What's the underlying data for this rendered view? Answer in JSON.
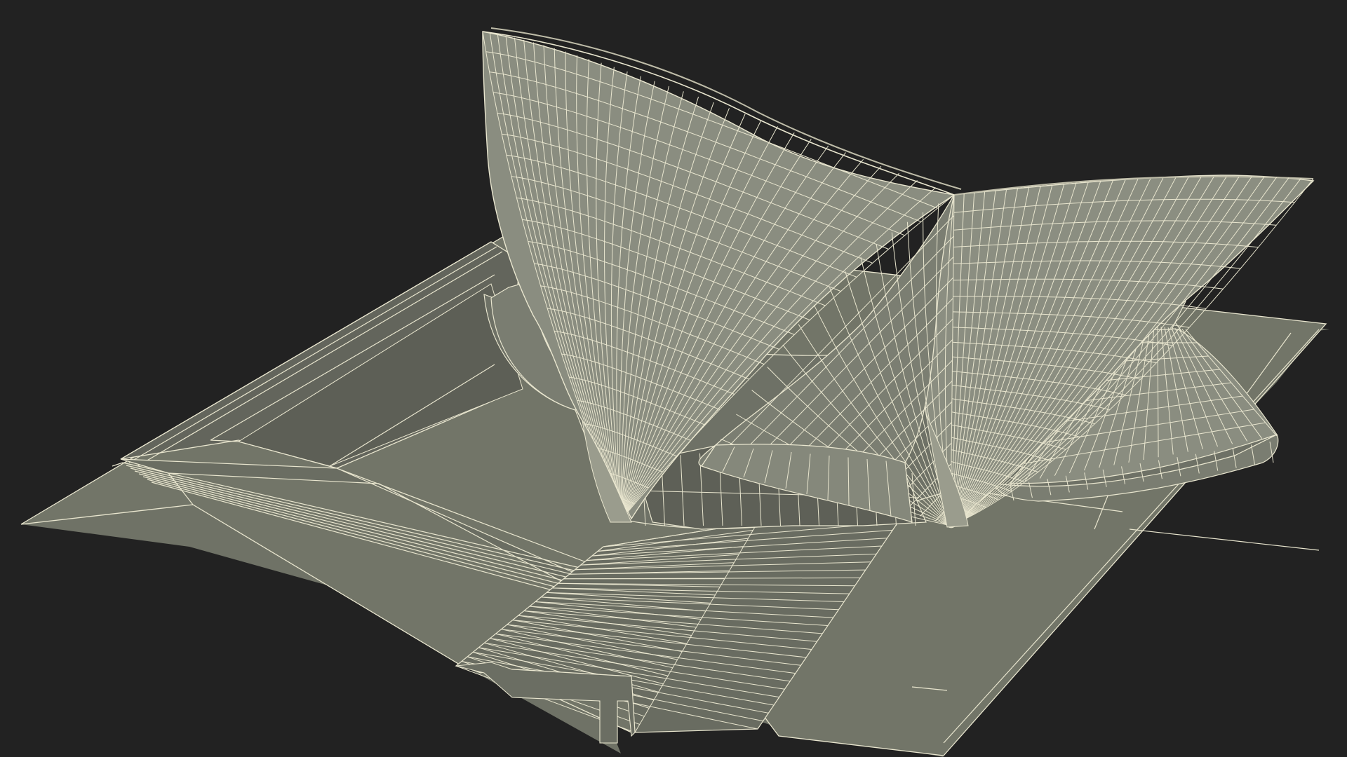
{
  "scene": {
    "subject": "",
    "render_style": "wireframe-on-shaded",
    "colors": {
      "background": "#222222",
      "surface_light": "#878a7e",
      "surface_mid": "#727568",
      "surface_dark": "#5b5d54",
      "surface_shadow": "#46473f",
      "wire": "#e9e6cf"
    }
  }
}
